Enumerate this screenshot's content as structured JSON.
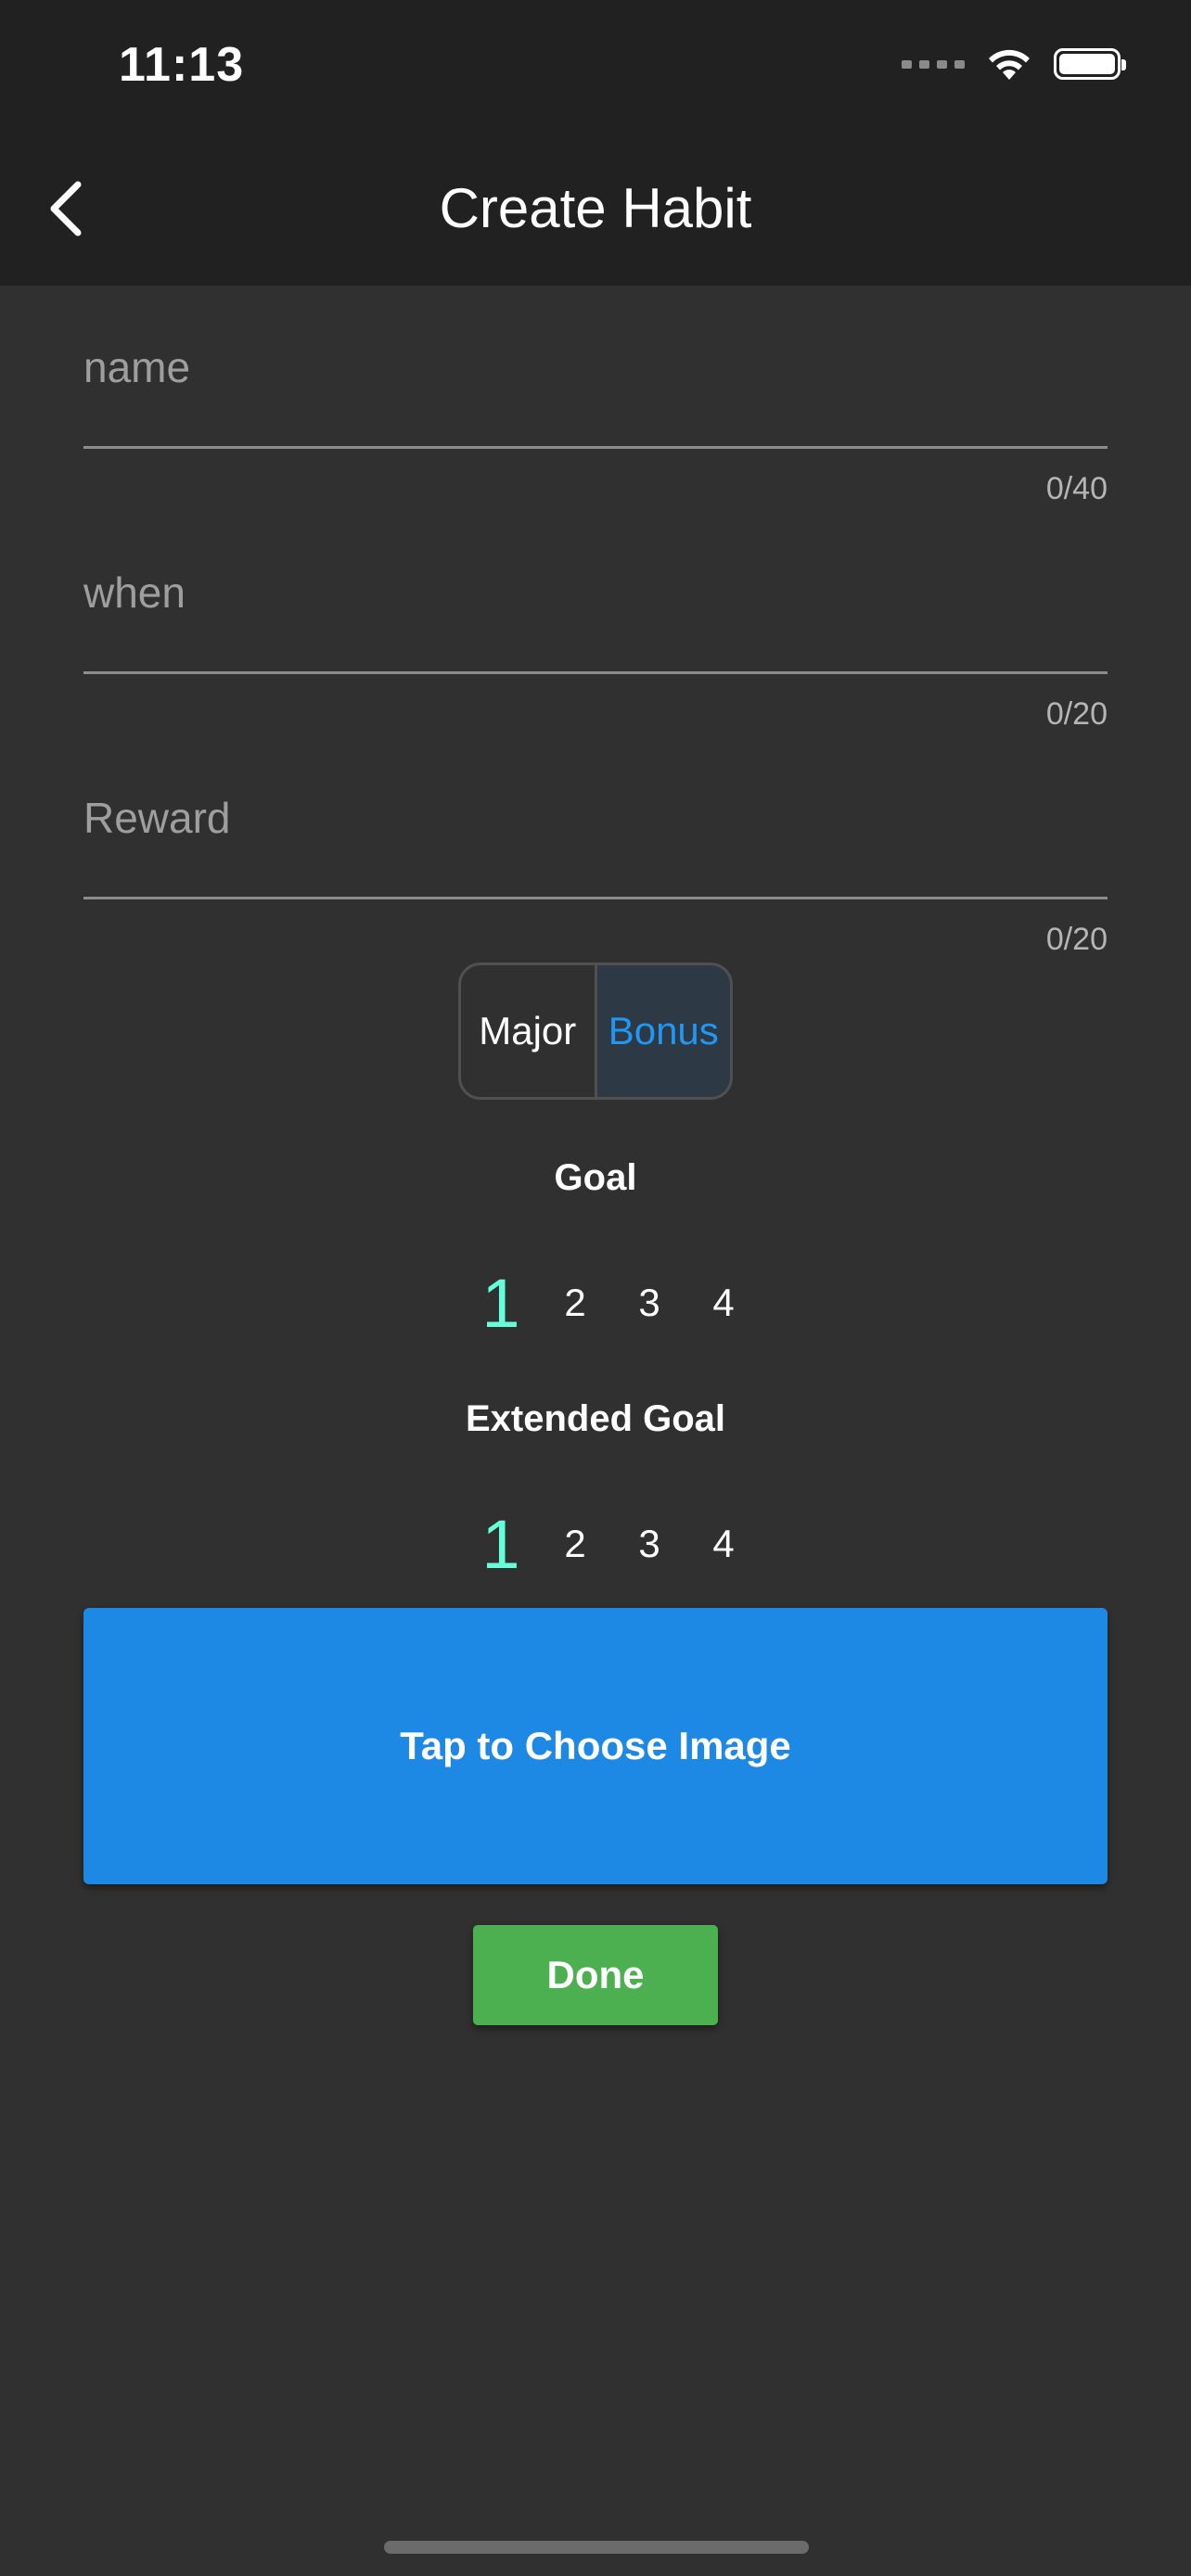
{
  "status_bar": {
    "time": "11:13"
  },
  "app_bar": {
    "title": "Create Habit",
    "back_icon": "chevron-left-icon"
  },
  "form": {
    "name": {
      "placeholder": "name",
      "value": "",
      "counter": "0/40"
    },
    "when": {
      "placeholder": "when",
      "value": "",
      "counter": "0/20"
    },
    "reward": {
      "placeholder": "Reward",
      "value": "",
      "counter": "0/20"
    }
  },
  "type_toggle": {
    "options": [
      "Major",
      "Bonus"
    ],
    "selected": "Bonus",
    "selected_color": "#2196f3"
  },
  "goal": {
    "label": "Goal",
    "options": [
      "1",
      "2",
      "3",
      "4"
    ],
    "selected": "1"
  },
  "extended_goal": {
    "label": "Extended Goal",
    "options": [
      "1",
      "2",
      "3",
      "4"
    ],
    "selected": "1"
  },
  "accent_color": "#64ffda",
  "image_button": {
    "label": "Tap to Choose Image",
    "color": "#1e88e5"
  },
  "done_button": {
    "label": "Done",
    "color": "#4caf50"
  }
}
